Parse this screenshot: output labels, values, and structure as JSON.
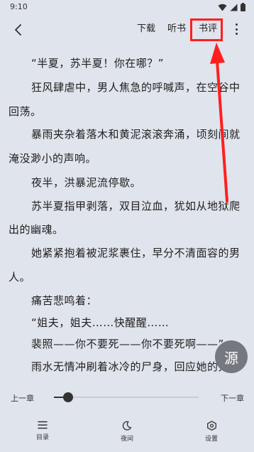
{
  "status": {
    "time": "9:10"
  },
  "toolbar": {
    "download": "下载",
    "listen": "听书",
    "review": "书评"
  },
  "content": {
    "paragraphs": [
      "“半夏，苏半夏！你在哪？”",
      "狂风肆虐中，男人焦急的呼喊声，在空谷中",
      "回荡。",
      "暴雨夹杂着落木和黄泥滚滚奔涌，顷刻间就",
      "淹没渺小的声响。",
      "夜半，洪暴泥流停歇。",
      "苏半夏指甲剥落，双目泣血，犹如从地狱爬",
      "出的幽魂。",
      "她紧紧抱着被泥浆裹住，早分不清面容的男",
      "人。",
      "痛苦悲鸣着：",
      "“姐夫，姐夫……快醒醒……",
      "裴照——你不要死——你不要死啊——”",
      "雨水无情冲刷着冰冷的尸身，回应她的只有"
    ]
  },
  "floating": {
    "source_label": "源"
  },
  "reader_controls": {
    "prev_chapter": "上一章",
    "next_chapter": "下一章",
    "progress": 0.1
  },
  "bottom_nav": {
    "catalog": "目录",
    "night": "夜间",
    "settings": "设置"
  },
  "colors": {
    "background": "#e0e4ec",
    "highlight": "#ff1f1f",
    "source_button": "#75787e"
  }
}
